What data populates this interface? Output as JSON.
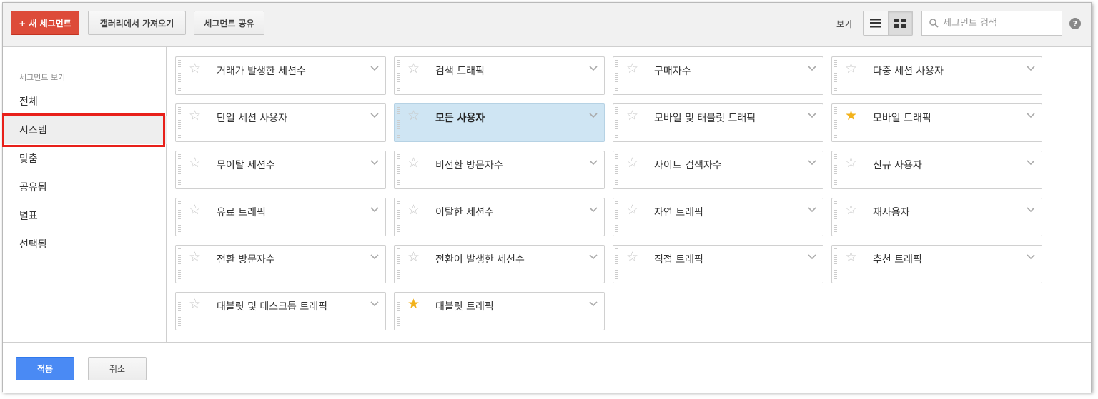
{
  "toolbar": {
    "new_segment": "+ 새 세그먼트",
    "import_gallery": "갤러리에서 가져오기",
    "share_segment": "세그먼트 공유",
    "view_label": "보기",
    "view_mode": "grid",
    "search_placeholder": "세그먼트 검색",
    "help": "?"
  },
  "sidebar": {
    "heading": "세그먼트 보기",
    "items": [
      {
        "label": "전체",
        "selected": false
      },
      {
        "label": "시스템",
        "selected": true
      },
      {
        "label": "맞춤",
        "selected": false
      },
      {
        "label": "공유됨",
        "selected": false
      },
      {
        "label": "별표",
        "selected": false
      },
      {
        "label": "선택됨",
        "selected": false
      }
    ]
  },
  "segments": [
    {
      "name": "거래가 발생한 세션수",
      "starred": false,
      "selected": false
    },
    {
      "name": "검색 트래픽",
      "starred": false,
      "selected": false
    },
    {
      "name": "구매자수",
      "starred": false,
      "selected": false
    },
    {
      "name": "다중 세션 사용자",
      "starred": false,
      "selected": false
    },
    {
      "name": "단일 세션 사용자",
      "starred": false,
      "selected": false
    },
    {
      "name": "모든 사용자",
      "starred": false,
      "selected": true
    },
    {
      "name": "모바일 및 태블릿 트래픽",
      "starred": false,
      "selected": false
    },
    {
      "name": "모바일 트래픽",
      "starred": true,
      "selected": false
    },
    {
      "name": "무이탈 세션수",
      "starred": false,
      "selected": false
    },
    {
      "name": "비전환 방문자수",
      "starred": false,
      "selected": false
    },
    {
      "name": "사이트 검색자수",
      "starred": false,
      "selected": false
    },
    {
      "name": "신규 사용자",
      "starred": false,
      "selected": false
    },
    {
      "name": "유료 트래픽",
      "starred": false,
      "selected": false
    },
    {
      "name": "이탈한 세션수",
      "starred": false,
      "selected": false
    },
    {
      "name": "자연 트래픽",
      "starred": false,
      "selected": false
    },
    {
      "name": "재사용자",
      "starred": false,
      "selected": false
    },
    {
      "name": "전환 방문자수",
      "starred": false,
      "selected": false
    },
    {
      "name": "전환이 발생한 세션수",
      "starred": false,
      "selected": false
    },
    {
      "name": "직접 트래픽",
      "starred": false,
      "selected": false
    },
    {
      "name": "추천 트래픽",
      "starred": false,
      "selected": false
    },
    {
      "name": "태블릿 및 데스크톱 트래픽",
      "starred": false,
      "selected": false
    },
    {
      "name": "태블릿 트래픽",
      "starred": true,
      "selected": false
    }
  ],
  "footer": {
    "apply": "적용",
    "cancel": "취소"
  },
  "colors": {
    "new_button": "#dd4b39",
    "apply_button": "#4a8af4",
    "selected_card": "#cfe5f3",
    "star_on": "#f2b21b",
    "highlight_box": "#e8201a"
  }
}
